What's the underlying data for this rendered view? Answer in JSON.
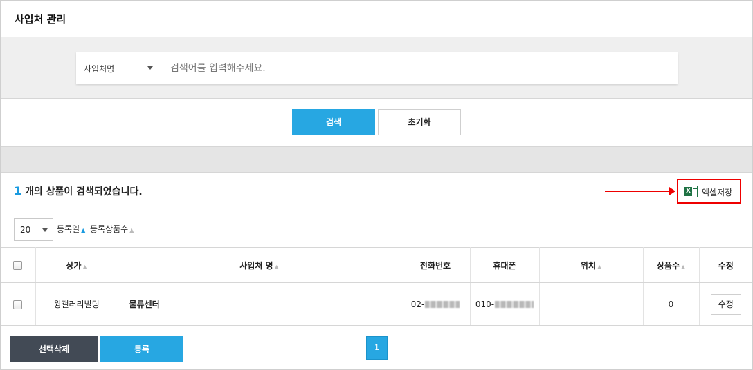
{
  "header": {
    "title": "사입처 관리"
  },
  "search": {
    "field_select": "사입처명",
    "placeholder": "검색어를 입력해주세요.",
    "search_label": "검색",
    "reset_label": "초기화"
  },
  "results": {
    "count": "1",
    "text": "개의 상품이 검색되었습니다.",
    "excel_label": "엑셀저장",
    "excel_badge": "X"
  },
  "listing": {
    "per_page": "20",
    "sort_options": [
      "등록일",
      "등록상품수"
    ]
  },
  "table": {
    "columns": [
      "상가",
      "사입처 명",
      "전화번호",
      "휴대폰",
      "위치",
      "상품수",
      "수정"
    ],
    "rows": [
      {
        "market": "윙갤러리빌딩",
        "name": "물류센터",
        "phone_prefix": "02-",
        "mobile_prefix": "010-",
        "location": "",
        "product_count": "0",
        "edit_label": "수정"
      }
    ]
  },
  "footer": {
    "delete_label": "선택삭제",
    "register_label": "등록",
    "current_page": "1"
  },
  "colors": {
    "accent": "#27a7e2",
    "dark_button": "#424a55",
    "highlight": "#ee0000",
    "excel_green": "#1f7244"
  }
}
